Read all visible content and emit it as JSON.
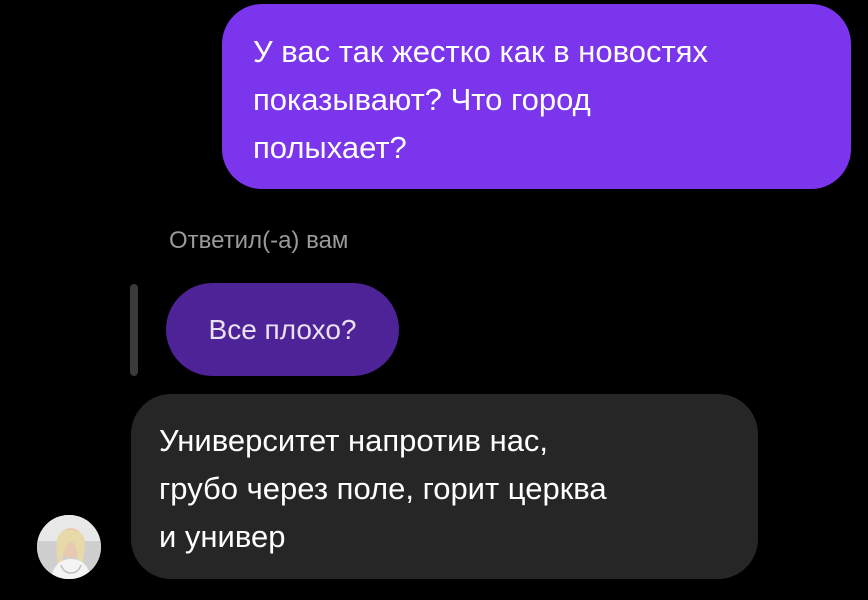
{
  "chat": {
    "outgoing_message": {
      "lines": [
        "У вас так жестко как в новостях",
        "показывают? Что город",
        "полыхает?"
      ],
      "bubble_color": "#7b35ec"
    },
    "reply_label": "Ответил(-а) вам",
    "quoted_message": {
      "text": "Все плохо?",
      "bubble_color": "#4f2398"
    },
    "incoming_message": {
      "lines": [
        "Университет напротив нас,",
        "грубо через поле, горит церква",
        "и универ"
      ],
      "bubble_color": "#262626"
    },
    "sender_avatar": {
      "icon": "user-avatar-photo"
    }
  }
}
